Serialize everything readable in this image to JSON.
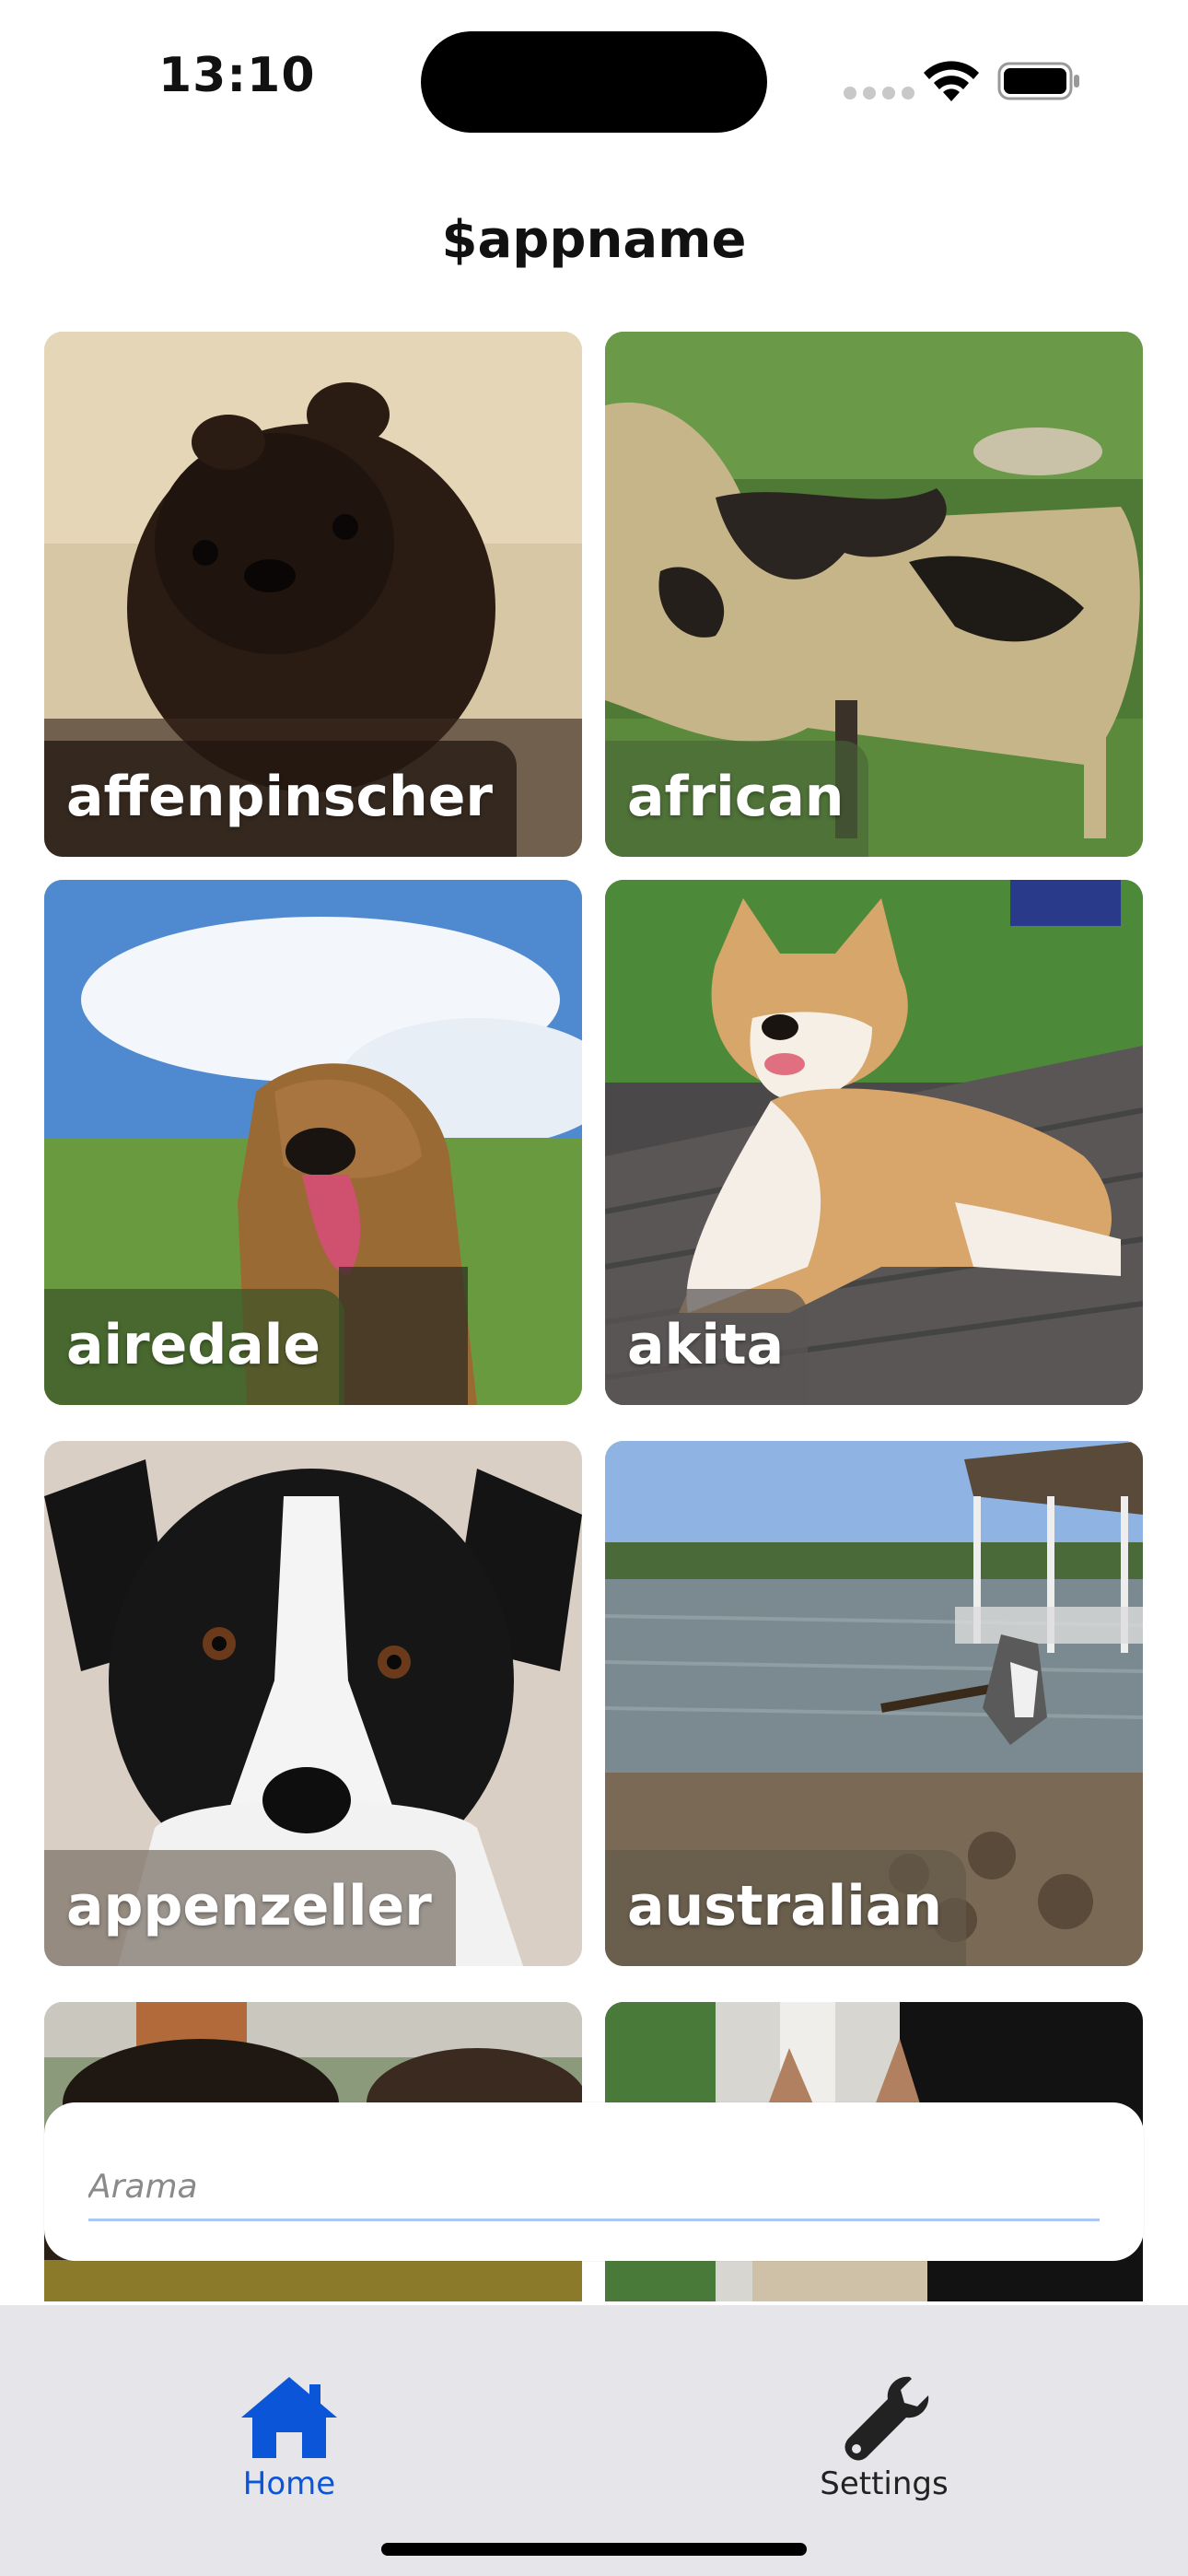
{
  "status_bar": {
    "time": "13:10"
  },
  "header": {
    "title": "$appname"
  },
  "breeds": [
    {
      "label": "affenpinscher",
      "photo": "black shaggy small dog on beige pillow",
      "accent": "#2a1a12"
    },
    {
      "label": "african",
      "photo": "african wild dog with patched coat on grass",
      "accent": "#3d5a2a"
    },
    {
      "label": "airedale",
      "photo": "airedale terrier in green meadow under blue sky",
      "accent": "#5a8a3a"
    },
    {
      "label": "akita",
      "photo": "akita lying on wooden deck",
      "accent": "#c99560"
    },
    {
      "label": "appenzeller",
      "photo": "black and white dog close-up portrait",
      "accent": "#1a1a1a"
    },
    {
      "label": "australian",
      "photo": "dog running in lake water with a stick",
      "accent": "#6a7c8a"
    },
    {
      "label": "",
      "photo": "dark dog outdoors near fence",
      "accent": "#2a2018"
    },
    {
      "label": "",
      "photo": "dog ears near window curtain",
      "accent": "#8a7a66"
    }
  ],
  "search": {
    "placeholder": "Arama"
  },
  "tabbar": {
    "active_color": "#0a55d8",
    "inactive_color": "#222222",
    "tabs": [
      {
        "label": "Home",
        "icon": "home-icon",
        "active": true
      },
      {
        "label": "Settings",
        "icon": "wrench-icon",
        "active": false
      }
    ]
  }
}
